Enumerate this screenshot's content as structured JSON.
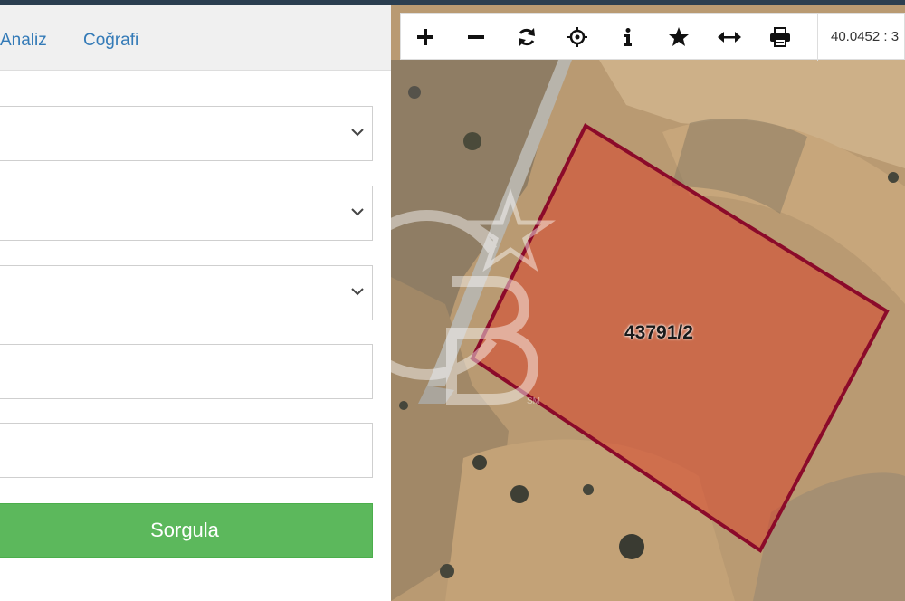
{
  "tabs": {
    "analiz": "Analiz",
    "cografi": "Coğrafi"
  },
  "form": {
    "select1_value": "",
    "select2_value": "",
    "select3_value": "",
    "input1_value": "",
    "input2_value": "",
    "submit_label": "Sorgula"
  },
  "map": {
    "coordinates": "40.0452 : 3",
    "parcel_label": "43791/2",
    "parcel_color": "#8b0a2a",
    "watermark_mark": "SM",
    "tools": [
      "plus-icon",
      "minus-icon",
      "refresh-icon",
      "locate-icon",
      "info-icon",
      "star-icon",
      "measure-icon",
      "print-icon"
    ]
  },
  "colors": {
    "accent": "#337ab7",
    "button": "#5cb85c"
  }
}
